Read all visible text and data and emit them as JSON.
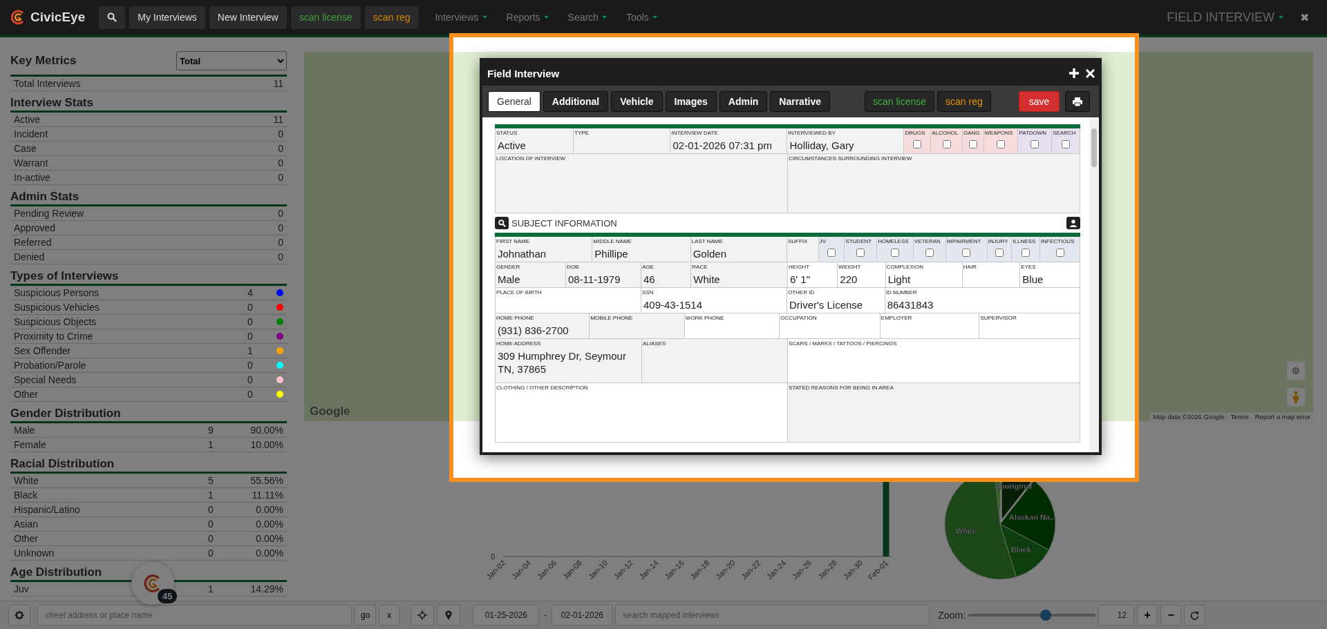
{
  "nav": {
    "brand": "CivicEye",
    "buttons": [
      {
        "label": "My Interviews",
        "kind": "plain"
      },
      {
        "label": "New Interview",
        "kind": "plain"
      },
      {
        "label": "scan license",
        "kind": "license"
      },
      {
        "label": "scan reg",
        "kind": "reg"
      }
    ],
    "menus": [
      "Interviews",
      "Reports",
      "Search",
      "Tools"
    ],
    "page_title": "FIELD INTERVIEW",
    "close": "✖"
  },
  "metrics": {
    "title": "Key Metrics",
    "select": "Total",
    "rows": [
      {
        "label": "Total Interviews",
        "count": "11"
      }
    ]
  },
  "sections": [
    {
      "title": "Interview Stats",
      "kind": "count",
      "rows": [
        {
          "label": "Active",
          "count": "11"
        },
        {
          "label": "Incident",
          "count": "0"
        },
        {
          "label": "Case",
          "count": "0"
        },
        {
          "label": "Warrant",
          "count": "0"
        },
        {
          "label": "In-active",
          "count": "0"
        }
      ]
    },
    {
      "title": "Admin Stats",
      "kind": "count",
      "rows": [
        {
          "label": "Pending Review",
          "count": "0"
        },
        {
          "label": "Approved",
          "count": "0"
        },
        {
          "label": "Referred",
          "count": "0"
        },
        {
          "label": "Denied",
          "count": "0"
        }
      ]
    },
    {
      "title": "Types of Interviews",
      "kind": "legend",
      "rows": [
        {
          "label": "Suspicious Persons",
          "count": "4",
          "color": "#0000ff"
        },
        {
          "label": "Suspicious Vehicles",
          "count": "0",
          "color": "#ff0000"
        },
        {
          "label": "Suspicious Objects",
          "count": "0",
          "color": "#008000"
        },
        {
          "label": "Proximity to Crime",
          "count": "0",
          "color": "#800080"
        },
        {
          "label": "Sex Offender",
          "count": "1",
          "color": "#ffa500"
        },
        {
          "label": "Probation/Parole",
          "count": "0",
          "color": "#00ffff"
        },
        {
          "label": "Special Needs",
          "count": "0",
          "color": "#ffc0cb"
        },
        {
          "label": "Other",
          "count": "0",
          "color": "#ffff00"
        }
      ]
    },
    {
      "title": "Gender Distribution",
      "kind": "percent",
      "rows": [
        {
          "label": "Male",
          "count": "9",
          "percent": "90.00%"
        },
        {
          "label": "Female",
          "count": "1",
          "percent": "10.00%"
        }
      ]
    },
    {
      "title": "Racial Distribution",
      "kind": "percent",
      "rows": [
        {
          "label": "White",
          "count": "5",
          "percent": "55.56%"
        },
        {
          "label": "Black",
          "count": "1",
          "percent": "11.11%"
        },
        {
          "label": "Hispanic/Latino",
          "count": "0",
          "percent": "0.00%"
        },
        {
          "label": "Asian",
          "count": "0",
          "percent": "0.00%"
        },
        {
          "label": "Other",
          "count": "0",
          "percent": "0.00%"
        },
        {
          "label": "Unknown",
          "count": "0",
          "percent": "0.00%"
        }
      ]
    },
    {
      "title": "Age Distribution",
      "kind": "percent",
      "rows": [
        {
          "label": "Juv",
          "count": "1",
          "percent": "14.29%"
        }
      ]
    }
  ],
  "map": {
    "logo": "Google",
    "attribution": "Map data ©2026 Google",
    "links": [
      "Terms",
      "Report a map error"
    ]
  },
  "activity_chart": {
    "y_tick": "0",
    "x_labels": [
      "Jan-02",
      "Jan-04",
      "Jan-06",
      "Jan-08",
      "Jan-10",
      "Jan-12",
      "Jan-14",
      "Jan-16",
      "Jan-18",
      "Jan-20",
      "Jan-22",
      "Jan-24",
      "Jan-26",
      "Jan-28",
      "Jan-30",
      "Feb-01"
    ]
  },
  "race_chart": {
    "labels": [
      "Aboriginal",
      "Alaskan Na...",
      "White",
      "Black"
    ]
  },
  "map_bar": {
    "address_placeholder": "street address or place name",
    "go": "go",
    "clear": "x",
    "date_from": "01-25-2026",
    "date_sep": "-",
    "date_to": "02-01-2026",
    "search_placeholder": "search mapped interviews",
    "zoom_label": "Zoom:",
    "zoom": {
      "level": 0.61
    },
    "zoom_value": "12",
    "zoom_in": "+",
    "zoom_out": "−"
  },
  "fab": {
    "badge": "45"
  },
  "modal": {
    "title": "Field Interview",
    "tabs": [
      {
        "label": "General",
        "selected": true
      },
      {
        "label": "Additional",
        "selected": false
      },
      {
        "label": "Vehicle",
        "selected": false
      },
      {
        "label": "Images",
        "selected": false
      },
      {
        "label": "Admin",
        "selected": false
      },
      {
        "label": "Narrative",
        "selected": false
      }
    ],
    "actions": [
      {
        "label": "scan license",
        "kind": "license"
      },
      {
        "label": "scan reg",
        "kind": "reg"
      },
      {
        "label": "save",
        "kind": "save"
      }
    ],
    "sections": [
      {
        "field_lines": [
          {
            "fields": [
              {
                "label": "STATUS",
                "value": "Active",
                "kind": "field"
              },
              {
                "label": "TYPE",
                "kind": "field"
              },
              {
                "label": "INTERVIEW DATE",
                "value": "02-01-2026 07:31 pm",
                "kind": "field"
              },
              {
                "label": "INTERVIEWED BY",
                "value": "Holliday, Gary",
                "kind": "field"
              },
              {
                "label": "DRUGS",
                "kind": "flag-check",
                "checked": false
              },
              {
                "label": "ALCOHOL",
                "kind": "flag-check",
                "checked": false
              },
              {
                "label": "GANG",
                "kind": "flag-check",
                "checked": false
              },
              {
                "label": "WEAPONS",
                "kind": "flag-check",
                "checked": false
              },
              {
                "label": "PATDOWN",
                "kind": "search-check",
                "checked": false
              },
              {
                "label": "SEARCH",
                "kind": "search-check",
                "checked": false
              }
            ]
          },
          {
            "fields": [
              {
                "label": "LOCATION OF INTERVIEW",
                "kind": "field"
              },
              {
                "label": "CIRCUMSTANCES SURROUNDING INTERVIEW",
                "kind": "field"
              }
            ]
          }
        ]
      },
      {
        "title": "SUBJECT INFORMATION",
        "field_lines": [
          {
            "fields": [
              {
                "label": "FIRST NAME",
                "value": "Johnathan",
                "kind": "field"
              },
              {
                "label": "MIDDLE NAME",
                "value": "Phillipe",
                "kind": "field"
              },
              {
                "label": "LAST NAME",
                "value": "Golden",
                "kind": "field"
              },
              {
                "label": "SUFFIX",
                "kind": "field"
              },
              {
                "label": "JV",
                "kind": "subject-check",
                "checked": false
              },
              {
                "label": "STUDENT",
                "kind": "subject-check",
                "checked": false
              },
              {
                "label": "HOMELESS",
                "kind": "subject-check",
                "checked": false
              },
              {
                "label": "VETERAN",
                "kind": "subject-check",
                "checked": false
              },
              {
                "label": "IMPAIRMENT",
                "kind": "subject-check",
                "checked": false
              },
              {
                "label": "INJURY",
                "kind": "subject-check",
                "checked": false
              },
              {
                "label": "ILLNESS",
                "kind": "subject-check",
                "checked": false
              },
              {
                "label": "INFECTIOUS",
                "kind": "subject-check",
                "checked": false
              }
            ]
          },
          {
            "fields": [
              {
                "label": "GENDER",
                "value": "Male",
                "kind": "field"
              },
              {
                "label": "DOB",
                "value": "08-11-1979",
                "kind": "field"
              },
              {
                "label": "AGE",
                "value": "46",
                "kind": "field"
              },
              {
                "label": "RACE",
                "value": "White",
                "kind": "field"
              },
              {
                "label": "HEIGHT",
                "value": "6' 1\"",
                "kind": "open-field"
              },
              {
                "label": "WEIGHT",
                "value": "220",
                "kind": "open-field"
              },
              {
                "label": "COMPLEXION",
                "value": "Light",
                "kind": "open-field"
              },
              {
                "label": "HAIR",
                "kind": "open-field"
              },
              {
                "label": "EYES",
                "value": "Blue",
                "kind": "open-field"
              }
            ]
          },
          {
            "fields": [
              {
                "label": "PLACE OF BIRTH",
                "kind": "open-field"
              },
              {
                "label": "SSN",
                "value": "409-43-1514",
                "kind": "open-field"
              },
              {
                "label": "OTHER ID",
                "value": "Driver's License",
                "kind": "open-field"
              },
              {
                "label": "ID NUMBER",
                "value": "86431843",
                "kind": "open-field"
              }
            ]
          },
          {
            "fields": [
              {
                "label": "HOME PHONE",
                "value": "(931) 836-2700",
                "kind": "field"
              },
              {
                "label": "MOBILE PHONE",
                "kind": "field"
              },
              {
                "label": "WORK PHONE",
                "kind": "open-field"
              },
              {
                "label": "OCCUPATION",
                "kind": "open-field"
              },
              {
                "label": "EMPLOYER",
                "kind": "open-field"
              },
              {
                "label": "SUPERVISOR",
                "kind": "open-field"
              }
            ]
          },
          {
            "fields": [
              {
                "label": "HOME ADDRESS",
                "value": "309 Humphrey Dr, Seymour TN, 37865",
                "kind": "field"
              },
              {
                "label": "ALIASES",
                "kind": "field"
              },
              {
                "label": "SCARS / MARKS / TATTOOS / PIERCINGS",
                "kind": "open-field"
              }
            ]
          },
          {
            "fields": [
              {
                "label": "CLOTHING / OTHER DESCRIPTION",
                "kind": "open-field"
              },
              {
                "label": "STATED REASONS FOR BEING IN AREA",
                "kind": "field"
              }
            ]
          }
        ]
      }
    ]
  }
}
